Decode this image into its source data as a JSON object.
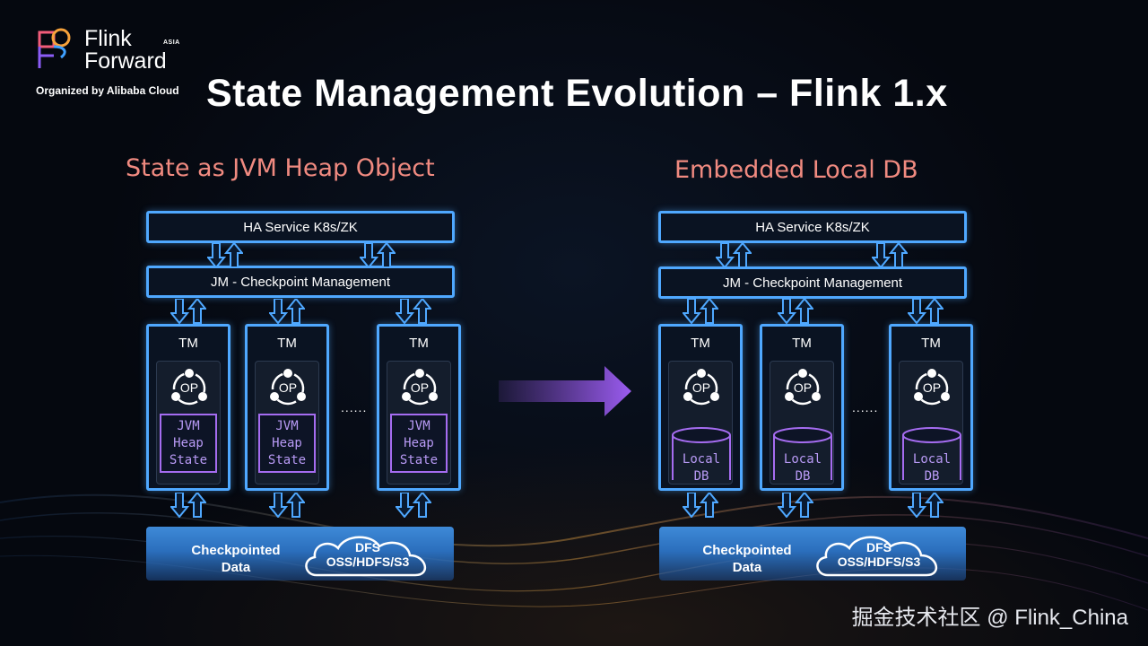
{
  "logo": {
    "line1": "Flink",
    "line2": "Forward",
    "badge": "ASIA",
    "organizer": "Organized by Alibaba Cloud"
  },
  "title": "State Management Evolution – Flink 1.x",
  "left": {
    "subtitle": "State as JVM Heap Object",
    "ha": "HA Service K8s/ZK",
    "jm": "JM - Checkpoint Management",
    "tms": [
      {
        "label": "TM",
        "op": "OP",
        "state": [
          "JVM",
          "Heap",
          "State"
        ]
      },
      {
        "label": "TM",
        "op": "OP",
        "state": [
          "JVM",
          "Heap",
          "State"
        ]
      },
      {
        "label": "TM",
        "op": "OP",
        "state": [
          "JVM",
          "Heap",
          "State"
        ]
      }
    ],
    "dots": "......",
    "storage": [
      "Checkpointed",
      "Data"
    ],
    "cloud": [
      "DFS",
      "OSS/HDFS/S3"
    ]
  },
  "right": {
    "subtitle": "Embedded Local DB",
    "ha": "HA Service K8s/ZK",
    "jm": "JM - Checkpoint Management",
    "tms": [
      {
        "label": "TM",
        "op": "OP",
        "state": [
          "Local",
          "DB"
        ]
      },
      {
        "label": "TM",
        "op": "OP",
        "state": [
          "Local",
          "DB"
        ]
      },
      {
        "label": "TM",
        "op": "OP",
        "state": [
          "Local",
          "DB"
        ]
      }
    ],
    "dots": "......",
    "storage": [
      "Checkpointed",
      "Data"
    ],
    "cloud": [
      "DFS",
      "OSS/HDFS/S3"
    ]
  },
  "watermark": "掘金技术社区 @ Flink_China",
  "colors": {
    "box_border": "#4fa8ff",
    "state_border": "#a56cf0",
    "subtitle": "#f08a80",
    "transition_arrow": "#8a4fd8"
  }
}
